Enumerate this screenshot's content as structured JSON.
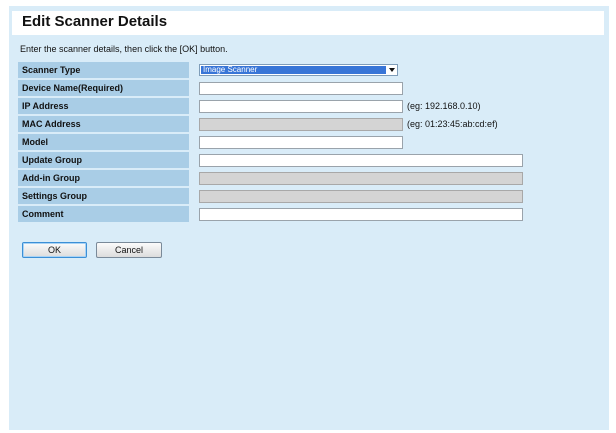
{
  "title": "Edit Scanner Details",
  "instruction": "Enter the scanner details, then click the [OK] button.",
  "fields": {
    "scanner_type": {
      "label": "Scanner Type",
      "value": "Image Scanner"
    },
    "device_name": {
      "label": "Device Name(Required)",
      "value": ""
    },
    "ip_address": {
      "label": "IP Address",
      "value": "",
      "hint": "(eg: 192.168.0.10)"
    },
    "mac_address": {
      "label": "MAC Address",
      "value": "",
      "hint": "(eg: 01:23:45:ab:cd:ef)"
    },
    "model": {
      "label": "Model",
      "value": ""
    },
    "update_group": {
      "label": "Update Group",
      "value": ""
    },
    "addin_group": {
      "label": "Add-in Group",
      "value": ""
    },
    "settings_group": {
      "label": "Settings Group",
      "value": ""
    },
    "comment": {
      "label": "Comment",
      "value": ""
    }
  },
  "buttons": {
    "ok": "OK",
    "cancel": "Cancel"
  },
  "colors": {
    "panel_background": "#d9ecf8",
    "label_cell": "#a9cde6",
    "selection_highlight": "#3875d7",
    "disabled_field": "#d4d4d4"
  }
}
